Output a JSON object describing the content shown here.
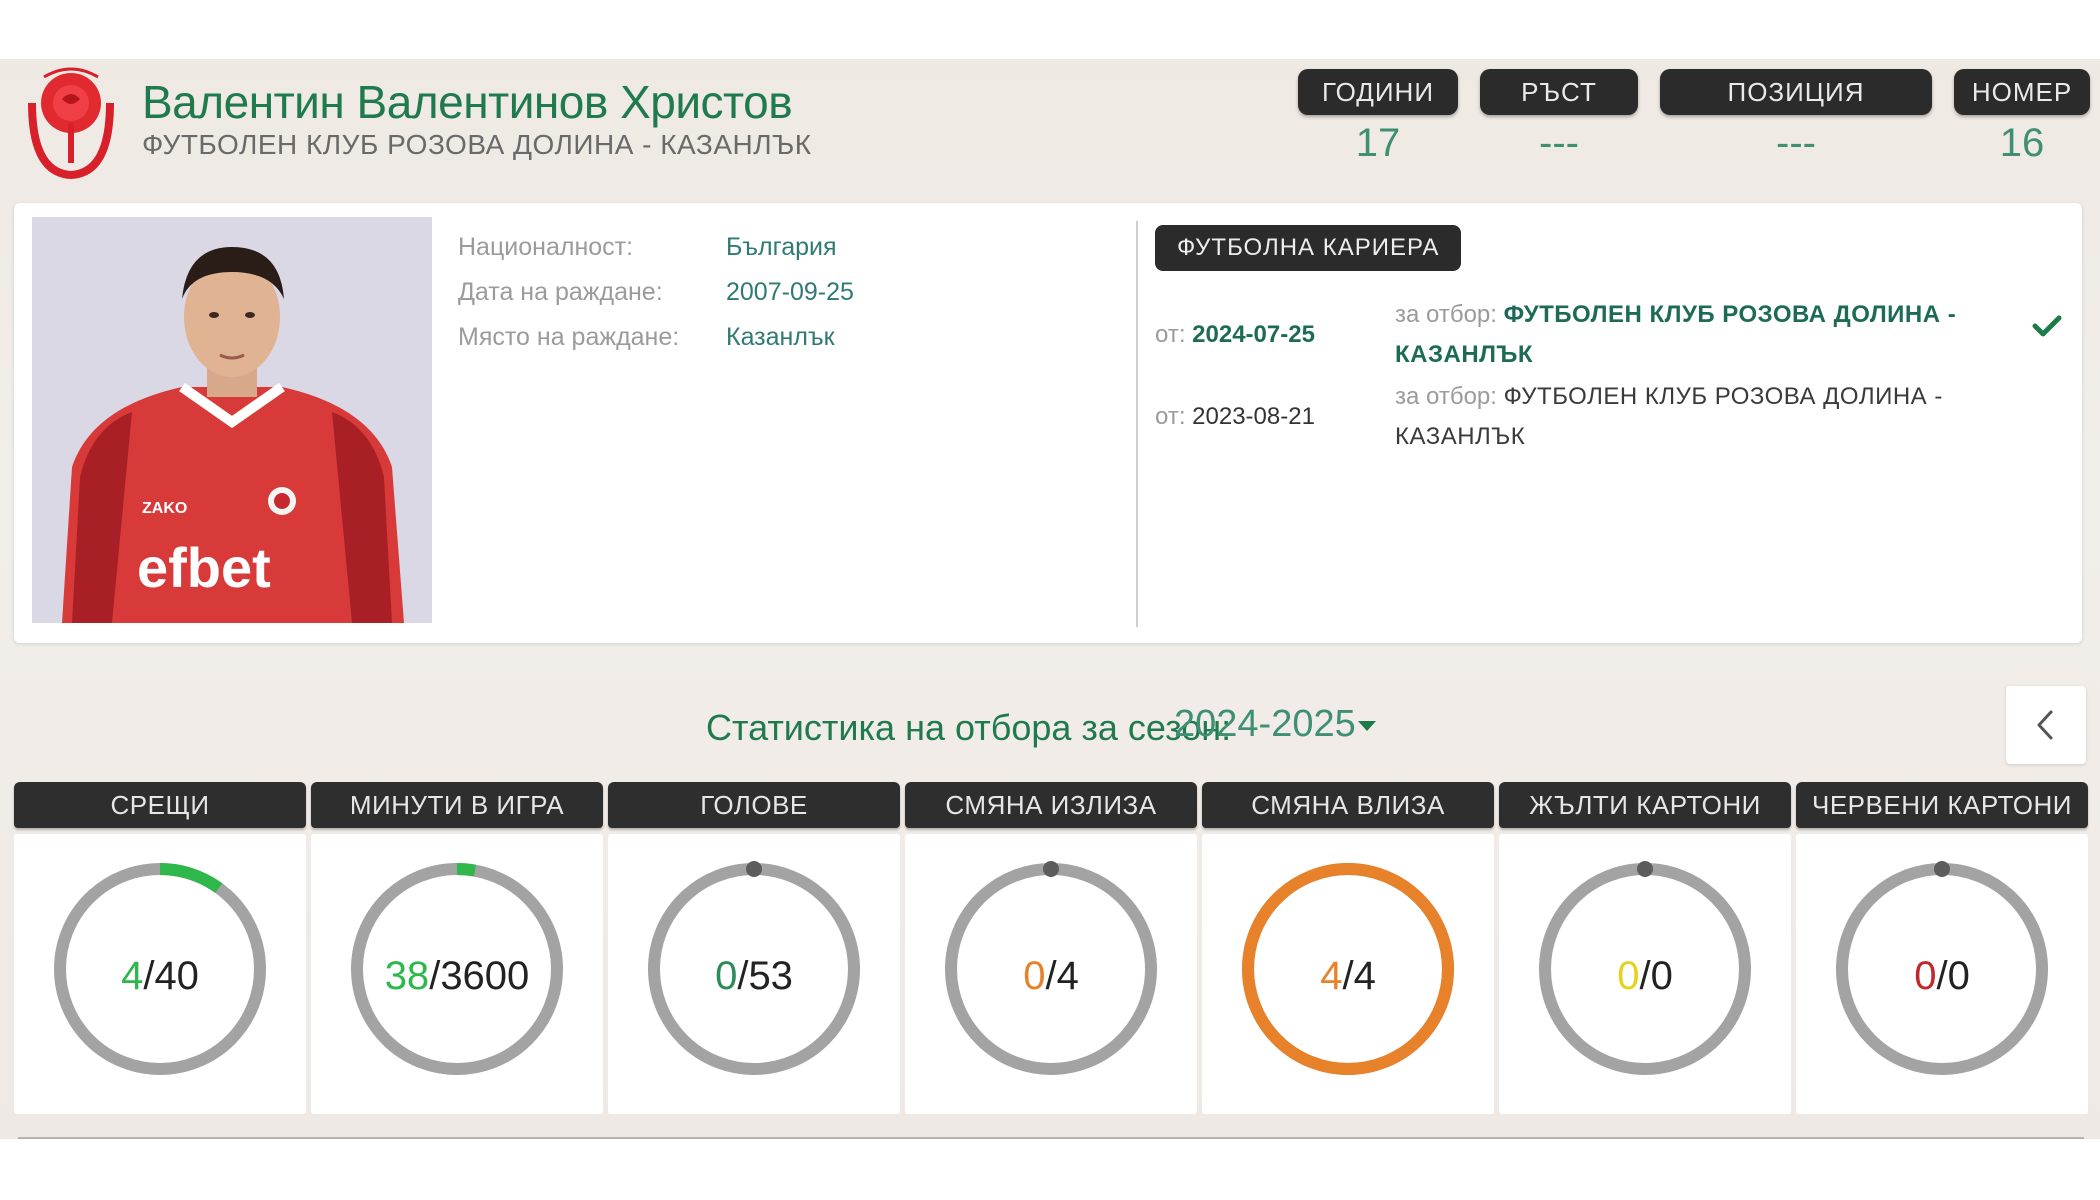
{
  "player": {
    "name": "Валентин Валентинов Христов",
    "club": "ФУТБОЛЕН КЛУБ РОЗОВА ДОЛИНА - КАЗАНЛЪК",
    "photo_shirt_text": "efbet",
    "photo_brand_text": "ZAKO"
  },
  "header_stats": [
    {
      "label": "ГОДИНИ",
      "value": "17"
    },
    {
      "label": "РЪСТ",
      "value": "---"
    },
    {
      "label": "ПОЗИЦИЯ",
      "value": "---"
    },
    {
      "label": "НОМЕР",
      "value": "16"
    }
  ],
  "details": [
    {
      "label": "Националност:",
      "value": "България"
    },
    {
      "label": "Дата на раждане:",
      "value": "2007-09-25"
    },
    {
      "label": "Място на раждане:",
      "value": "Казанлък"
    }
  ],
  "career": {
    "title": "ФУТБОЛНА КАРИЕРА",
    "from_label": "от:",
    "team_label": "за отбор:",
    "entries": [
      {
        "date": "2024-07-25",
        "team": "ФУТБОЛЕН КЛУБ РОЗОВА ДОЛИНА - КАЗАНЛЪК",
        "current": true
      },
      {
        "date": "2023-08-21",
        "team": "ФУТБОЛЕН КЛУБ РОЗОВА ДОЛИНА - КАЗАНЛЪК",
        "current": false
      }
    ]
  },
  "season": {
    "label": "Статистика на отбора за сезон:",
    "selected": "2024-2025"
  },
  "stats": [
    {
      "label": "СРЕЩИ",
      "value": 4,
      "total": 40,
      "fraction": 0.1,
      "color": "#2eb84c"
    },
    {
      "label": "МИНУТИ В ИГРА",
      "value": 38,
      "total": 3600,
      "fraction": 0.011,
      "color": "#2eb84c"
    },
    {
      "label": "ГОЛОВЕ",
      "value": 0,
      "total": 53,
      "fraction": 0,
      "color": "#2e8b57"
    },
    {
      "label": "СМЯНА ИЗЛИЗА",
      "value": 0,
      "total": 4,
      "fraction": 0,
      "color": "#e8822a"
    },
    {
      "label": "СМЯНА ВЛИЗА",
      "value": 4,
      "total": 4,
      "fraction": 1,
      "color": "#e8822a"
    },
    {
      "label": "ЖЪЛТИ КАРТОНИ",
      "value": 0,
      "total": 0,
      "fraction": 0,
      "color": "#e5d21a"
    },
    {
      "label": "ЧЕРВЕНИ КАРТОНИ",
      "value": 0,
      "total": 0,
      "fraction": 0,
      "color": "#c0282b"
    }
  ],
  "colors": {
    "accent_green": "#1f7a4d",
    "ring_track": "#a3a3a3",
    "pill_dark": "#2b2b2b"
  }
}
